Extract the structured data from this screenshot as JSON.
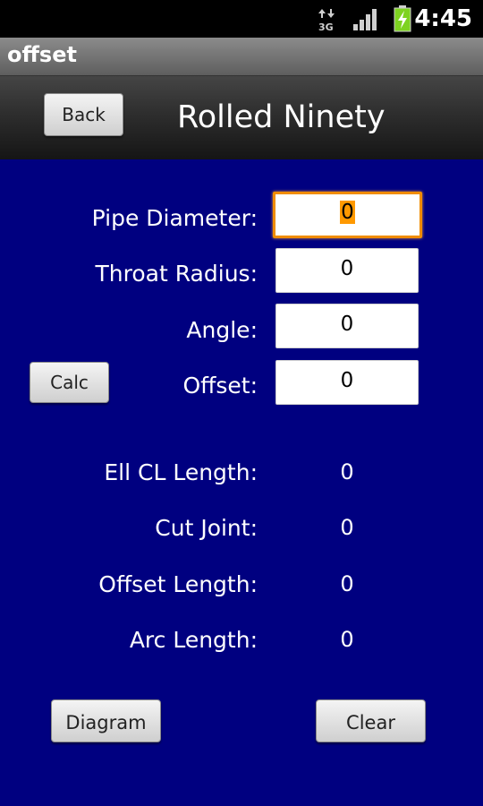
{
  "status_bar": {
    "time": "4:45",
    "network_label": "3G",
    "icons": [
      "data-arrows-3g-icon",
      "signal-strength-icon",
      "battery-charging-icon"
    ]
  },
  "app": {
    "title": "offset"
  },
  "header": {
    "back_label": "Back",
    "title": "Rolled Ninety"
  },
  "inputs": [
    {
      "label": "Pipe Diameter:",
      "value": "0"
    },
    {
      "label": "Throat Radius:",
      "value": "0"
    },
    {
      "label": "Angle:",
      "value": "0"
    },
    {
      "label": "Offset:",
      "value": "0"
    }
  ],
  "calc_label": "Calc",
  "results": [
    {
      "label": "Ell CL Length:",
      "value": "0"
    },
    {
      "label": "Cut Joint:",
      "value": "0"
    },
    {
      "label": "Offset Length:",
      "value": "0"
    },
    {
      "label": "Arc Length:",
      "value": "0"
    }
  ],
  "buttons": {
    "diagram_label": "Diagram",
    "clear_label": "Clear"
  },
  "colors": {
    "background": "#000080",
    "focus_border": "#f08c00",
    "battery": "#7ed321"
  }
}
